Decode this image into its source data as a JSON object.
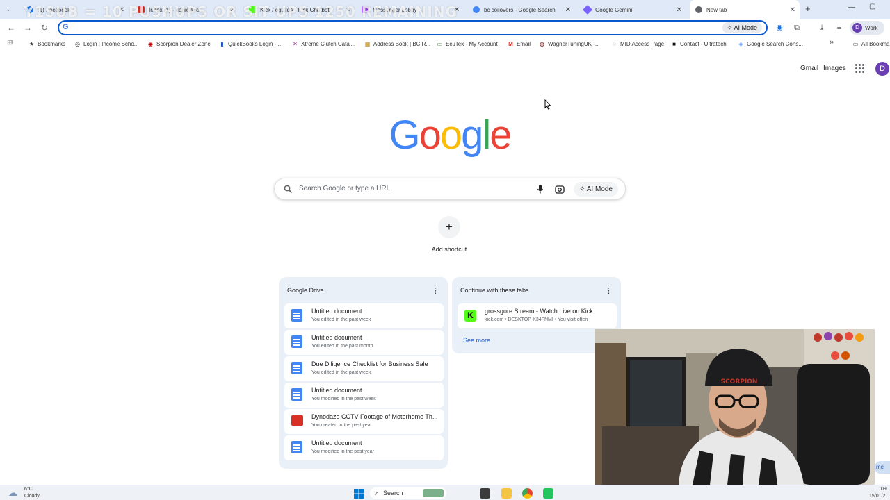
{
  "overlay_text": "Y1SUB = 10 PUSHUPS OR SIT UPS 1250 REMAINING",
  "tabs": [
    {
      "title": "(1) Facebook",
      "color": "#1877f2"
    },
    {
      "title": "Inbox (1) - daniel@cr...",
      "color": "#d93025"
    },
    {
      "title": "Kick / oguilds - Kick Chatbot",
      "color": "#53fc18"
    },
    {
      "title": "Messenger Lobby",
      "color": "#a142f4"
    },
    {
      "title": "bc coilovers - Google Search",
      "color": "#4285f4"
    },
    {
      "title": "Google Gemini",
      "color": "#7b61ff"
    },
    {
      "title": "New tab",
      "color": "#5f6368"
    }
  ],
  "toolbar": {
    "ai_mode": "AI Mode",
    "profile_label": "Work",
    "profile_initial": "D"
  },
  "bookmarks": [
    {
      "label": "Bookmarks",
      "icon": "★"
    },
    {
      "label": "Login | Income Scho...",
      "icon": "◎"
    },
    {
      "label": "Scorpion Dealer Zone",
      "icon": "◉"
    },
    {
      "label": "QuickBooks Login -...",
      "icon": "▮"
    },
    {
      "label": "Xtreme Clutch Catal...",
      "icon": "✕"
    },
    {
      "label": "Address Book | BC R...",
      "icon": "▦"
    },
    {
      "label": "EcuTek - My Account",
      "icon": "▭"
    },
    {
      "label": "Email",
      "icon": "M"
    },
    {
      "label": "WagnerTuningUK -...",
      "icon": "◍"
    },
    {
      "label": "MID Access Page",
      "icon": "◌"
    },
    {
      "label": "Contact - Ultratech",
      "icon": "■"
    },
    {
      "label": "Google Search Cons...",
      "icon": "◈"
    }
  ],
  "bookmarks_overflow": "»",
  "all_bookmarks": "All Bookmarks",
  "header": {
    "gmail": "Gmail",
    "images": "Images",
    "avatar": "D"
  },
  "search": {
    "placeholder": "Search Google or type a URL",
    "ai_mode": "AI Mode"
  },
  "shortcut": {
    "label": "Add shortcut"
  },
  "drive": {
    "title": "Google Drive",
    "items": [
      {
        "title": "Untitled document",
        "subtitle": "You edited in the past week",
        "type": "doc"
      },
      {
        "title": "Untitled document",
        "subtitle": "You edited in the past month",
        "type": "doc"
      },
      {
        "title": "Due Diligence Checklist for Business Sale",
        "subtitle": "You edited in the past week",
        "type": "doc"
      },
      {
        "title": "Untitled document",
        "subtitle": "You modified in the past week",
        "type": "doc"
      },
      {
        "title": "Dynodaze CCTV Footage of Motorhome Th...",
        "subtitle": "You created in the past year",
        "type": "video"
      },
      {
        "title": "Untitled document",
        "subtitle": "You modified in the past year",
        "type": "doc"
      }
    ]
  },
  "continue": {
    "title": "Continue with these tabs",
    "item": {
      "title": "grossgore Stream - Watch Live on Kick",
      "subtitle": "kick.com • DESKTOP-K34FNMI • You visit often"
    },
    "see_more": "See more"
  },
  "taskbar": {
    "weather_temp": "6°C",
    "weather_desc": "Cloudy",
    "search": "Search",
    "time": "09",
    "date": "15/01/2"
  }
}
